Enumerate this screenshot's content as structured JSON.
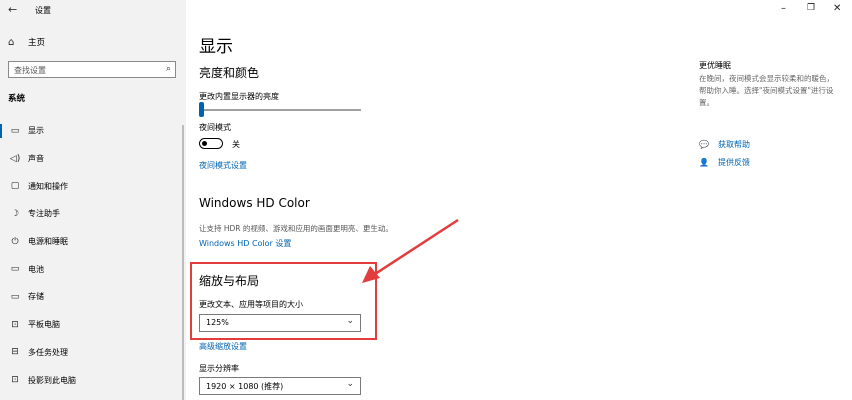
{
  "window": {
    "back": "←",
    "title": "设置",
    "controls": {
      "minimize": "–",
      "restore": "❐",
      "close": "✕"
    }
  },
  "sidebar": {
    "home_label": "主页",
    "search_placeholder": "查找设置",
    "section_label": "系统",
    "items": [
      {
        "label": "显示",
        "icon": "display-icon",
        "glyph": "▭",
        "active": true
      },
      {
        "label": "声音",
        "icon": "speaker-icon",
        "glyph": "🔈",
        "active": false
      },
      {
        "label": "通知和操作",
        "icon": "notification-icon",
        "glyph": "▢",
        "active": false
      },
      {
        "label": "专注助手",
        "icon": "moon-icon",
        "glyph": "☽",
        "active": false
      },
      {
        "label": "电源和睡眠",
        "icon": "power-icon",
        "glyph": "⏻",
        "active": false
      },
      {
        "label": "电池",
        "icon": "battery-icon",
        "glyph": "▭",
        "active": false
      },
      {
        "label": "存储",
        "icon": "storage-icon",
        "glyph": "▭",
        "active": false
      },
      {
        "label": "平板电脑",
        "icon": "tablet-icon",
        "glyph": "⊡",
        "active": false
      },
      {
        "label": "多任务处理",
        "icon": "multitask-icon",
        "glyph": "⊟",
        "active": false
      },
      {
        "label": "投影到此电脑",
        "icon": "project-icon",
        "glyph": "⊡",
        "active": false
      }
    ]
  },
  "main": {
    "page_title": "显示",
    "brightness": {
      "heading": "亮度和颜色",
      "slider_label": "更改内置显示器的亮度",
      "slider_value": 0
    },
    "night_light": {
      "label": "夜间模式",
      "state": "关",
      "settings_link": "夜间模式设置"
    },
    "hdr": {
      "heading": "Windows HD Color",
      "desc": "让支持 HDR 的视频、游戏和应用的画面更明亮、更生动。",
      "link": "Windows HD Color 设置"
    },
    "scale": {
      "heading": "缩放与布局",
      "label": "更改文本、应用等项目的大小",
      "value": "125%",
      "advanced_link": "高级缩放设置"
    },
    "resolution": {
      "label": "显示分辨率",
      "value": "1920 × 1080 (推荐)"
    }
  },
  "right": {
    "title": "更优睡眠",
    "desc": "在晚间，夜间模式会显示较柔和的暖色，帮助你入睡。选择\"夜间模式设置\"进行设置。",
    "help": {
      "label": "获取帮助",
      "icon": "help-icon"
    },
    "feedback": {
      "label": "提供反馈",
      "icon": "feedback-icon"
    }
  },
  "colors": {
    "accent": "#0063b1",
    "highlight": "#e23c3c"
  }
}
